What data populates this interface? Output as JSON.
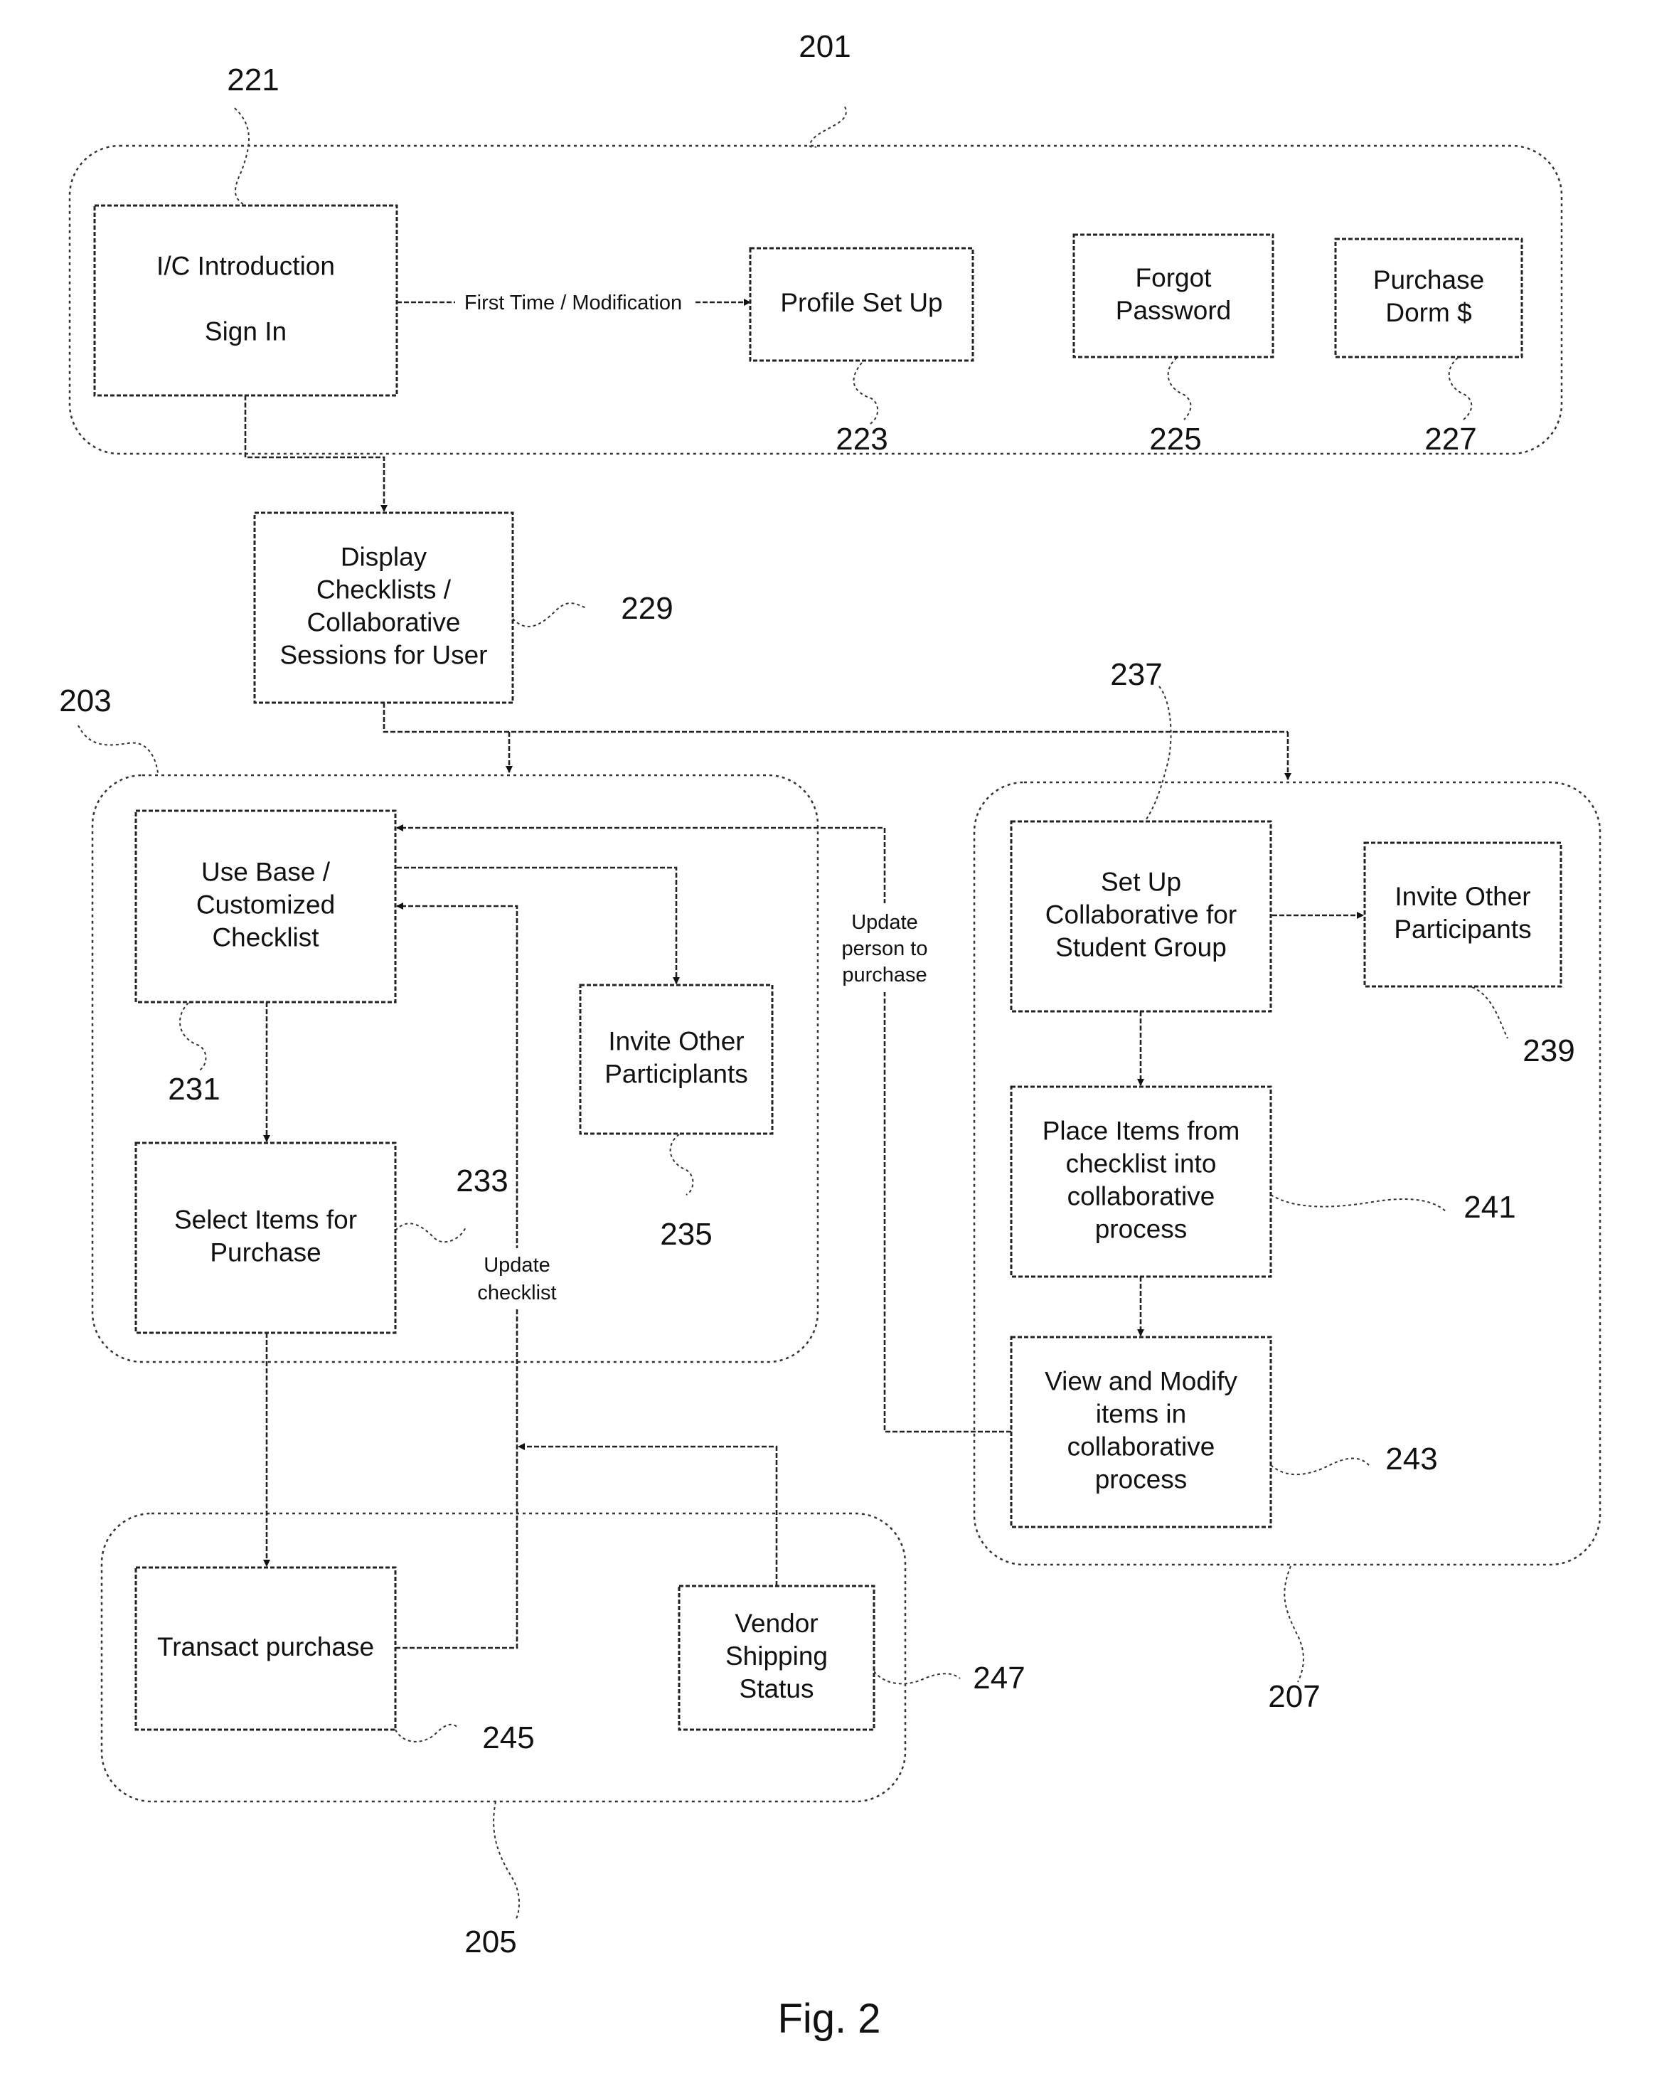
{
  "figure_caption": "Fig. 2",
  "groups": {
    "g201": {
      "ref": "201"
    },
    "g203": {
      "ref": "203"
    },
    "g205": {
      "ref": "205"
    },
    "g207": {
      "ref": "207"
    }
  },
  "nodes": {
    "n221": {
      "ref": "221",
      "lines": [
        "I/C Introduction",
        "",
        "Sign In"
      ]
    },
    "n223": {
      "ref": "223",
      "lines": [
        "Profile Set Up"
      ]
    },
    "n225": {
      "ref": "225",
      "lines": [
        "Forgot",
        "Password"
      ]
    },
    "n227": {
      "ref": "227",
      "lines": [
        "Purchase",
        "Dorm $"
      ]
    },
    "n229": {
      "ref": "229",
      "lines": [
        "Display",
        "Checklists /",
        "Collaborative",
        "Sessions for User"
      ]
    },
    "n231": {
      "ref": "231",
      "lines": [
        "Use Base /",
        "Customized",
        "Checklist"
      ]
    },
    "n233": {
      "ref": "233",
      "lines": [
        "Select Items for",
        "Purchase"
      ]
    },
    "n235": {
      "ref": "235",
      "lines": [
        "Invite Other",
        "Participlants"
      ]
    },
    "n237": {
      "ref": "237",
      "lines": [
        "Set Up",
        "Collaborative for",
        "Student Group"
      ]
    },
    "n239": {
      "ref": "239",
      "lines": [
        "Invite Other",
        "Participants"
      ]
    },
    "n241": {
      "ref": "241",
      "lines": [
        "Place Items from",
        "checklist into",
        "collaborative",
        "process"
      ]
    },
    "n243": {
      "ref": "243",
      "lines": [
        "View and Modify",
        "items in",
        "collaborative",
        "process"
      ]
    },
    "n245": {
      "ref": "245",
      "lines": [
        "Transact purchase"
      ]
    },
    "n247": {
      "ref": "247",
      "lines": [
        "Vendor",
        "Shipping",
        "Status"
      ]
    }
  },
  "edge_labels": {
    "first_time": "First Time / Modification",
    "update_person": [
      "Update",
      "person to",
      "purchase"
    ],
    "update_checklist": [
      "Update",
      "checklist"
    ]
  },
  "edges": [
    {
      "from": "221",
      "to": "223",
      "label": "First Time / Modification"
    },
    {
      "from": "221",
      "to": "229"
    },
    {
      "from": "229",
      "to": "203"
    },
    {
      "from": "229",
      "to": "207"
    },
    {
      "from": "231",
      "to": "235",
      "bidirectional": true
    },
    {
      "from": "231",
      "to": "233"
    },
    {
      "from": "233",
      "to": "245"
    },
    {
      "from": "245",
      "to": "231",
      "label": "Update checklist"
    },
    {
      "from": "247",
      "to": "231"
    },
    {
      "from": "237",
      "to": "239",
      "bidirectional": true
    },
    {
      "from": "237",
      "to": "241"
    },
    {
      "from": "241",
      "to": "243"
    },
    {
      "from": "243",
      "to": "231",
      "label": "Update person to purchase"
    }
  ]
}
